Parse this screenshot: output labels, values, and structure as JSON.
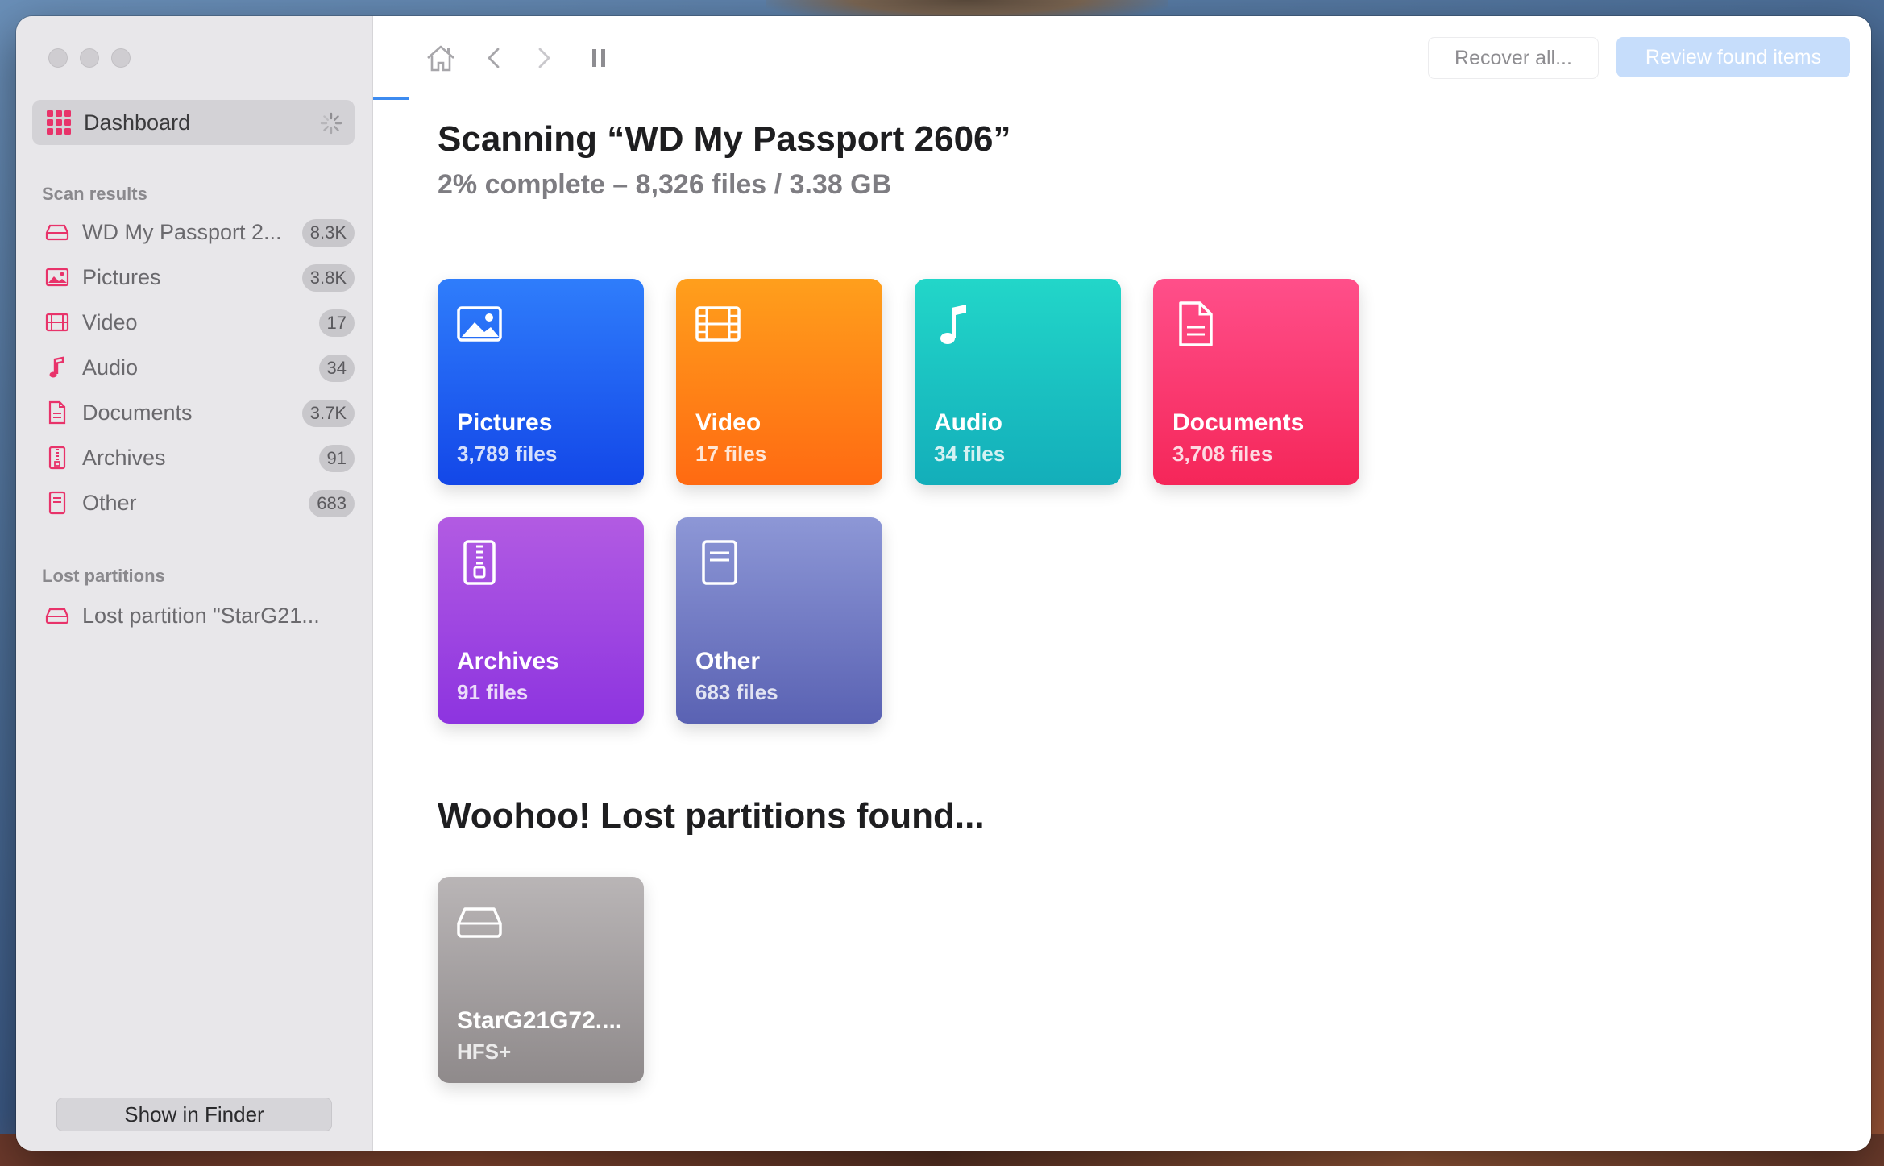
{
  "sidebar": {
    "dashboard": {
      "label": "Dashboard",
      "icon": "grid-icon"
    },
    "scan_results_title": "Scan results",
    "items": [
      {
        "label": "WD My Passport 2...",
        "count": "8.3K",
        "icon": "drive-icon"
      },
      {
        "label": "Pictures",
        "count": "3.8K",
        "icon": "picture-icon"
      },
      {
        "label": "Video",
        "count": "17",
        "icon": "film-icon"
      },
      {
        "label": "Audio",
        "count": "34",
        "icon": "music-icon"
      },
      {
        "label": "Documents",
        "count": "3.7K",
        "icon": "document-icon"
      },
      {
        "label": "Archives",
        "count": "91",
        "icon": "archive-icon"
      },
      {
        "label": "Other",
        "count": "683",
        "icon": "other-icon"
      }
    ],
    "lost_partitions_title": "Lost partitions",
    "lost_items": [
      {
        "label": "Lost partition \"StarG21...",
        "icon": "drive-icon"
      }
    ],
    "show_in_finder": "Show in Finder"
  },
  "toolbar": {
    "recover_all": "Recover all...",
    "review_found": "Review found items"
  },
  "main": {
    "title": "Scanning “WD My Passport 2606”",
    "subtitle": "2% complete – 8,326 files / 3.38 GB",
    "progress_fraction": 0.02,
    "tiles": [
      {
        "name": "Pictures",
        "count": "3,789 files",
        "icon": "picture-icon",
        "colors": [
          "#2f7dfb",
          "#1347e8"
        ]
      },
      {
        "name": "Video",
        "count": "17 files",
        "icon": "film-icon",
        "colors": [
          "#ff9f1c",
          "#ff6a12"
        ]
      },
      {
        "name": "Audio",
        "count": "34 files",
        "icon": "music-icon",
        "colors": [
          "#22d6c9",
          "#13aeba"
        ]
      },
      {
        "name": "Documents",
        "count": "3,708 files",
        "icon": "document-icon",
        "colors": [
          "#ff4f8a",
          "#f52659"
        ]
      },
      {
        "name": "Archives",
        "count": "91 files",
        "icon": "archive-icon",
        "colors": [
          "#b25be2",
          "#8d34e0"
        ]
      },
      {
        "name": "Other",
        "count": "683 files",
        "icon": "other-icon",
        "colors": [
          "#8d97d6",
          "#5a62b3"
        ]
      }
    ],
    "lost_title": "Woohoo! Lost partitions found...",
    "lost_tiles": [
      {
        "name": "StarG21G72....",
        "format": "HFS+",
        "icon": "drive-icon",
        "colors": [
          "#b9b5b6",
          "#8f8a8b"
        ]
      }
    ]
  },
  "colors": {
    "accent": "#3d8bf0",
    "sidebar_icon": "#e8336a"
  }
}
